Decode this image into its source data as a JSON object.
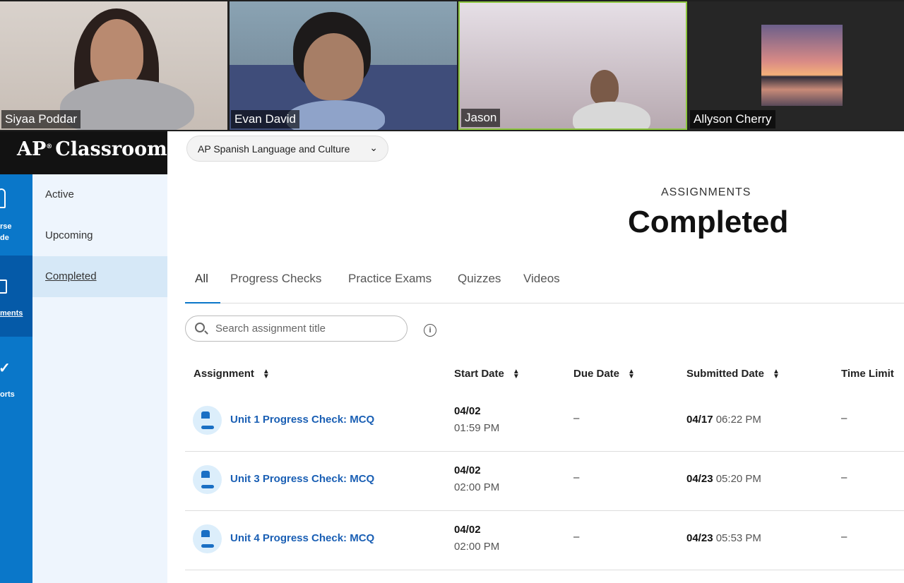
{
  "participants": [
    {
      "name": "Siyaa Poddar"
    },
    {
      "name": "Evan David"
    },
    {
      "name": "Jason",
      "active_speaker": true
    },
    {
      "name": "Allyson Cherry"
    }
  ],
  "app": {
    "title": "AP",
    "title_rest": "Classroom",
    "reg": "®"
  },
  "rail": [
    {
      "icon": "map-pin-icon",
      "lines": [
        "rse",
        "de"
      ]
    },
    {
      "icon": "assignments-icon",
      "lines": [
        "ments"
      ],
      "selected": true
    },
    {
      "icon": "checkmark-icon",
      "lines": [
        "orts"
      ]
    }
  ],
  "subnav": [
    {
      "label": "Active"
    },
    {
      "label": "Upcoming"
    },
    {
      "label": "Completed",
      "selected": true
    }
  ],
  "course_select": {
    "value": "AP Spanish Language and Culture"
  },
  "page": {
    "kicker": "ASSIGNMENTS",
    "title": "Completed"
  },
  "tabs": [
    {
      "label": "All",
      "selected": true
    },
    {
      "label": "Progress Checks"
    },
    {
      "label": "Practice Exams"
    },
    {
      "label": "Quizzes"
    },
    {
      "label": "Videos"
    }
  ],
  "search": {
    "placeholder": "Search assignment title",
    "info": "i"
  },
  "columns": [
    "Assignment",
    "Start Date",
    "Due Date",
    "Submitted Date",
    "Time Limit"
  ],
  "rows": [
    {
      "title": "Unit 1 Progress Check: MCQ",
      "start_date": "04/02",
      "start_time": "01:59 PM",
      "due": "–",
      "sub_date": "04/17",
      "sub_time": "06:22 PM",
      "limit": "–"
    },
    {
      "title": "Unit 3 Progress Check: MCQ",
      "start_date": "04/02",
      "start_time": "02:00 PM",
      "due": "–",
      "sub_date": "04/23",
      "sub_time": "05:20 PM",
      "limit": "–"
    },
    {
      "title": "Unit 4 Progress Check: MCQ",
      "start_date": "04/02",
      "start_time": "02:00 PM",
      "due": "–",
      "sub_date": "04/23",
      "sub_time": "05:53 PM",
      "limit": "–"
    }
  ],
  "colors": {
    "brand_blue": "#0a77c9",
    "link": "#1a5fb4",
    "speaker_border": "#8dc63f"
  }
}
